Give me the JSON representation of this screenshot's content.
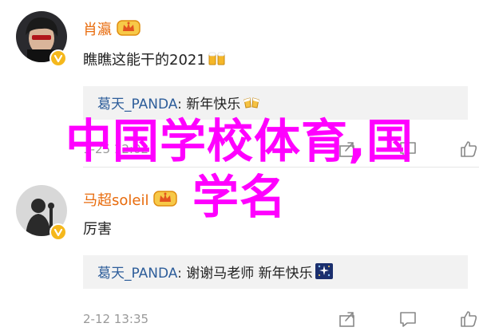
{
  "comments": [
    {
      "username": "肖瀛",
      "text": "瞧瞧这能干的2021",
      "reply": {
        "user": "葛天_PANDA",
        "separator": ":",
        "text": "新年快乐"
      },
      "timestamp": "1-25 12:02"
    },
    {
      "username": "马超soleil",
      "text": "厉害",
      "reply": {
        "user": "葛天_PANDA",
        "separator": ":",
        "text": "谢谢马老师 新年快乐"
      },
      "timestamp": "2-12 13:35"
    }
  ],
  "watermark": {
    "line1": "中国学校体育,国",
    "line2": "学名"
  },
  "colors": {
    "username": "#e86b0c",
    "reply_user": "#2d5d9a",
    "timestamp": "#999999",
    "reply_bg": "#f2f2f2",
    "watermark": "#ff00ff",
    "verified_badge": "#f5b81c"
  },
  "icons": {
    "vip_badge": "crown-badge-icon",
    "verified": "verified-v-icon",
    "share": "share-icon",
    "comment": "comment-icon",
    "like": "thumbs-up-icon",
    "emoji_1": "beer-cheers-emoji",
    "emoji_2": "cheers-emoji",
    "emoji_3": "sparkles-emoji"
  }
}
